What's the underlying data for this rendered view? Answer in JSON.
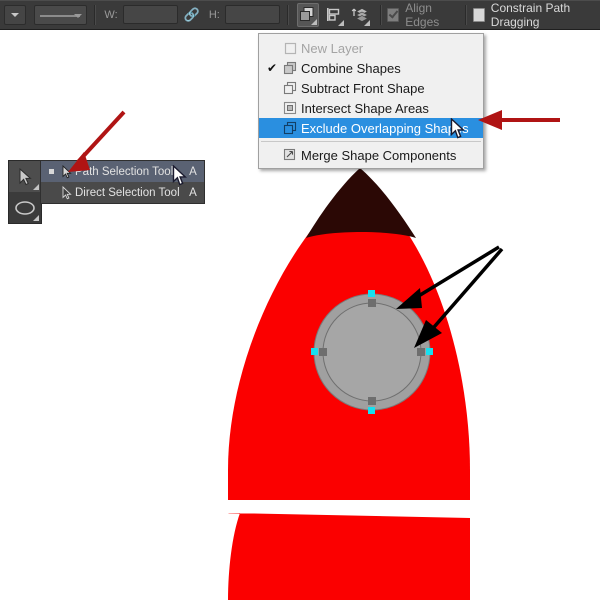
{
  "app": {
    "accent_blue": "#2a8fe0",
    "annotation_red": "#b01414",
    "annotation_black": "#000000",
    "rocket_red": "#fb0000",
    "rocket_nose": "#2b0805",
    "porthole_gray": "#a0a0a0",
    "toolbar_bg": "#3a3a3a",
    "menu_bg": "#f0f0f0"
  },
  "options_bar": {
    "preset_picker": {
      "name": "tool-preset-picker",
      "caret": "caret-down-icon"
    },
    "stroke_options": {
      "name": "stroke-options-dropdown",
      "line": "stroke-line-icon"
    },
    "width": {
      "label": "W:",
      "value": "",
      "placeholder": ""
    },
    "link_icon": "link-chain-icon",
    "height": {
      "label": "H:",
      "value": "",
      "placeholder": ""
    },
    "path_operations_button": "path-operations-icon",
    "path_alignment_button": "path-alignment-icon",
    "path_arrangement_button": "path-arrangement-icon",
    "align_edges": {
      "label": "Align Edges",
      "checked": true,
      "disabled": true
    },
    "constrain_path_dragging": {
      "label": "Constrain Path Dragging",
      "checked": false,
      "disabled": false
    }
  },
  "path_op_menu": {
    "items": [
      {
        "label": "New Layer",
        "icon": "new-layer-icon",
        "checked": false,
        "disabled": true,
        "selected": false
      },
      {
        "label": "Combine Shapes",
        "icon": "combine-shapes-icon",
        "checked": true,
        "disabled": false,
        "selected": false
      },
      {
        "label": "Subtract Front Shape",
        "icon": "subtract-front-shape-icon",
        "checked": false,
        "disabled": false,
        "selected": false
      },
      {
        "label": "Intersect Shape Areas",
        "icon": "intersect-shape-areas-icon",
        "checked": false,
        "disabled": false,
        "selected": false
      },
      {
        "label": "Exclude Overlapping Shapes",
        "icon": "exclude-overlapping-shapes-icon",
        "checked": false,
        "disabled": false,
        "selected": true
      }
    ],
    "merge_item": {
      "label": "Merge Shape Components",
      "icon": "merge-shape-components-icon"
    },
    "check_mark": "✔"
  },
  "tool_palette": {
    "path_selection_button": "path-selection-tool-icon",
    "ellipse_button": "ellipse-tool-icon"
  },
  "tool_flyout": {
    "items": [
      {
        "label": "Path Selection Tool",
        "shortcut": "A",
        "icon": "path-selection-arrow-icon",
        "selected": true
      },
      {
        "label": "Direct Selection Tool",
        "shortcut": "A",
        "icon": "direct-selection-arrow-icon",
        "selected": false
      }
    ]
  },
  "annotations": {
    "red_arrow_to_menu_item": {
      "name": "red-arrow-to-exclude-overlapping-shapes",
      "color": "#b01414"
    },
    "red_arrow_to_path_selection_tool": {
      "name": "red-arrow-to-path-selection-tool",
      "color": "#b01414"
    },
    "black_arrow_porthole_outer": {
      "name": "black-arrow-to-porthole-outer-ring",
      "color": "#000000"
    },
    "black_arrow_porthole_inner": {
      "name": "black-arrow-to-porthole-inner-ring",
      "color": "#000000"
    }
  },
  "artwork": {
    "name": "rocket-illustration",
    "body_color": "#fb0000",
    "nose_color": "#2b0805",
    "porthole_fill": "#a0a0a0",
    "porthole_stroke": "#6f6f6f",
    "anchor_color": "#6e6e6e",
    "handle_color": "#16e0f0"
  }
}
